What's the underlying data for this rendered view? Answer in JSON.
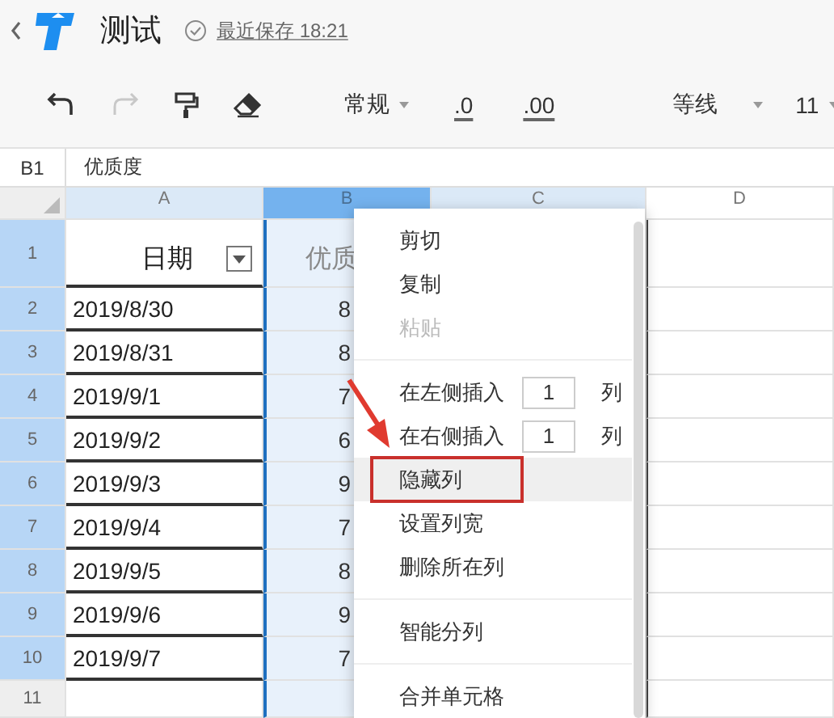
{
  "titlebar": {
    "title": "测试",
    "save_status": "最近保存 18:21"
  },
  "toolbar": {
    "icons": [
      {
        "kind": "undo",
        "disabled": false
      },
      {
        "kind": "redo",
        "disabled": true
      },
      {
        "kind": "painter",
        "disabled": false
      },
      {
        "kind": "eraser",
        "disabled": false
      }
    ],
    "number_format": "常规",
    "decimal_buttons": [
      ".0",
      ".00"
    ],
    "font": "等线",
    "font_size": "11"
  },
  "formula_bar": {
    "cell_ref": "B1",
    "value": "优质度"
  },
  "sheet": {
    "columns": [
      {
        "label": "A",
        "selected": false,
        "in_range": true
      },
      {
        "label": "B",
        "selected": true,
        "in_range": true
      },
      {
        "label": "C",
        "selected": false,
        "in_range": true
      },
      {
        "label": "D",
        "selected": false,
        "in_range": false
      }
    ],
    "rows": [
      {
        "label": "1",
        "selected": true,
        "kind": "header",
        "cells": [
          "日期",
          "优质"
        ]
      },
      {
        "label": "2",
        "selected": true,
        "kind": "data",
        "cells": [
          "2019/8/30",
          "8"
        ]
      },
      {
        "label": "3",
        "selected": true,
        "kind": "data",
        "cells": [
          "2019/8/31",
          "8"
        ]
      },
      {
        "label": "4",
        "selected": true,
        "kind": "data",
        "cells": [
          "2019/9/1",
          "7"
        ]
      },
      {
        "label": "5",
        "selected": true,
        "kind": "data",
        "cells": [
          "2019/9/2",
          "6"
        ]
      },
      {
        "label": "6",
        "selected": true,
        "kind": "data",
        "cells": [
          "2019/9/3",
          "9"
        ]
      },
      {
        "label": "7",
        "selected": true,
        "kind": "data",
        "cells": [
          "2019/9/4",
          "7"
        ]
      },
      {
        "label": "8",
        "selected": true,
        "kind": "data",
        "cells": [
          "2019/9/5",
          "8"
        ]
      },
      {
        "label": "9",
        "selected": true,
        "kind": "data",
        "cells": [
          "2019/9/6",
          "9"
        ]
      },
      {
        "label": "10",
        "selected": true,
        "kind": "data",
        "cells": [
          "2019/9/7",
          "7"
        ]
      },
      {
        "label": "11",
        "selected": false,
        "kind": "empty",
        "cells": []
      }
    ]
  },
  "context_menu": {
    "items": [
      {
        "kind": "item",
        "label": "剪切",
        "disabled": false,
        "selected": false,
        "annotated": false
      },
      {
        "kind": "item",
        "label": "复制",
        "disabled": false,
        "selected": false,
        "annotated": false
      },
      {
        "kind": "item",
        "label": "粘贴",
        "disabled": true,
        "selected": false,
        "annotated": false
      },
      {
        "kind": "separator"
      },
      {
        "kind": "insert",
        "label": "在左侧插入",
        "count": "1",
        "unit": "列",
        "disabled": false,
        "selected": false,
        "annotated": false
      },
      {
        "kind": "insert",
        "label": "在右侧插入",
        "count": "1",
        "unit": "列",
        "disabled": false,
        "selected": false,
        "annotated": false
      },
      {
        "kind": "item",
        "label": "隐藏列",
        "disabled": false,
        "selected": true,
        "annotated": true
      },
      {
        "kind": "item",
        "label": "设置列宽",
        "disabled": false,
        "selected": false,
        "annotated": false
      },
      {
        "kind": "item",
        "label": "删除所在列",
        "disabled": false,
        "selected": false,
        "annotated": false
      },
      {
        "kind": "separator"
      },
      {
        "kind": "item",
        "label": "智能分列",
        "disabled": false,
        "selected": false,
        "annotated": false
      },
      {
        "kind": "separator"
      },
      {
        "kind": "item",
        "label": "合并单元格",
        "disabled": false,
        "selected": false,
        "annotated": false
      }
    ]
  }
}
